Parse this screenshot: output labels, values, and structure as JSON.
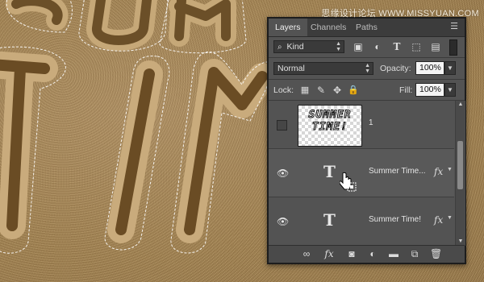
{
  "watermark": "思缘设计论坛 WWW.MISSYUAN.COM",
  "panel": {
    "tabs": [
      "Layers",
      "Channels",
      "Paths"
    ],
    "active_tab": "Layers",
    "filter": {
      "label": "Kind"
    },
    "blend_mode": "Normal",
    "opacity_label": "Opacity:",
    "opacity_value": "100%",
    "lock_label": "Lock:",
    "fill_label": "Fill:",
    "fill_value": "100%",
    "layers": [
      {
        "name": "1",
        "type": "image",
        "visible": false,
        "thumb_text": "SUMMER TIME!"
      },
      {
        "name": "Summer Time...",
        "type": "text",
        "visible": true,
        "fx": "fx"
      },
      {
        "name": "Summer Time!",
        "type": "text",
        "visible": true,
        "fx": "fx"
      }
    ]
  },
  "colors": {
    "panel_bg": "#535353",
    "panel_border": "#1d1d1d",
    "sand": "#a98957"
  },
  "icons": {
    "filter": [
      "image-filter-icon",
      "adjustment-filter-icon",
      "type-filter-icon",
      "shape-filter-icon",
      "smart-object-filter-icon"
    ],
    "lock": [
      "lock-transparent-icon",
      "lock-image-icon",
      "lock-position-icon",
      "lock-all-icon"
    ],
    "bottom": [
      "link-icon",
      "fx-icon",
      "mask-icon",
      "adjustment-icon",
      "folder-icon",
      "new-layer-icon",
      "trash-icon"
    ]
  }
}
